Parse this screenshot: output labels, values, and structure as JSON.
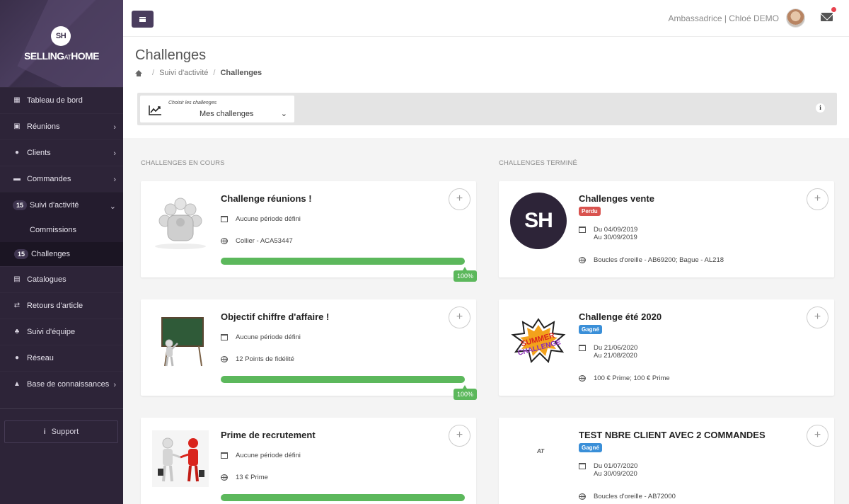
{
  "brand": {
    "logo_mark": "SH",
    "logo_text_a": "SELLING",
    "logo_text_b": "AT",
    "logo_text_c": "HOME"
  },
  "sidebar": {
    "items": [
      {
        "label": "Tableau de bord",
        "icon": "dashboard-icon"
      },
      {
        "label": "Réunions",
        "icon": "calendar-icon"
      },
      {
        "label": "Clients",
        "icon": "users-icon"
      },
      {
        "label": "Commandes",
        "icon": "card-icon"
      },
      {
        "label": "Suivi d'activité",
        "icon": "activity-icon",
        "badge": "15"
      },
      {
        "label": "Commissions"
      },
      {
        "label": "Challenges",
        "badge": "15"
      },
      {
        "label": "Catalogues",
        "icon": "catalog-icon"
      },
      {
        "label": "Retours d'article",
        "icon": "exchange-icon"
      },
      {
        "label": "Suivi d'équipe",
        "icon": "sitemap-icon"
      },
      {
        "label": "Réseau",
        "icon": "globe-icon"
      },
      {
        "label": "Base de connaissances",
        "icon": "graduation-icon"
      }
    ],
    "support_label": "Support"
  },
  "topbar": {
    "user_label": "Ambassadrice | Chloé DEMO"
  },
  "header": {
    "title": "Challenges",
    "breadcrumb": {
      "parent": "Suivi d'activité",
      "current": "Challenges"
    },
    "filter": {
      "caption": "Choisir les challenges",
      "value": "Mes challenges"
    }
  },
  "columns": {
    "ongoing_title": "CHALLENGES EN COURS",
    "finished_title": "CHALLENGES TERMINÉ"
  },
  "ongoing": [
    {
      "title": "Challenge réunions !",
      "period": "Aucune période défini",
      "reward": "Collier - ACA53447",
      "progress": "100%"
    },
    {
      "title": "Objectif chiffre d'affaire !",
      "period": "Aucune période défini",
      "reward": "12 Points de fidélité",
      "progress": "100%"
    },
    {
      "title": "Prime de recrutement",
      "period": "Aucune période défini",
      "reward": "13 € Prime",
      "progress": "100%"
    }
  ],
  "finished": [
    {
      "title": "Challenges vente",
      "status": "Perdu",
      "status_color": "#d9534f",
      "date_from": "Du 04/09/2019",
      "date_to": "Au 30/09/2019",
      "reward": "Boucles d'oreille - AB69200; Bague - AL218"
    },
    {
      "title": "Challenge été 2020",
      "status": "Gagné",
      "status_color": "#3a8fd8",
      "date_from": "Du 21/06/2020",
      "date_to": "Au 21/08/2020",
      "reward": "100 € Prime; 100 € Prime"
    },
    {
      "title": "TEST NBRE CLIENT AVEC 2 COMMANDES",
      "status": "Gagné",
      "status_color": "#3a8fd8",
      "date_from": "Du 01/07/2020",
      "date_to": "Au 30/09/2020",
      "reward": "Boucles d'oreille - AB72000",
      "image_text": "AT"
    }
  ],
  "sh_logo_text": "SH"
}
